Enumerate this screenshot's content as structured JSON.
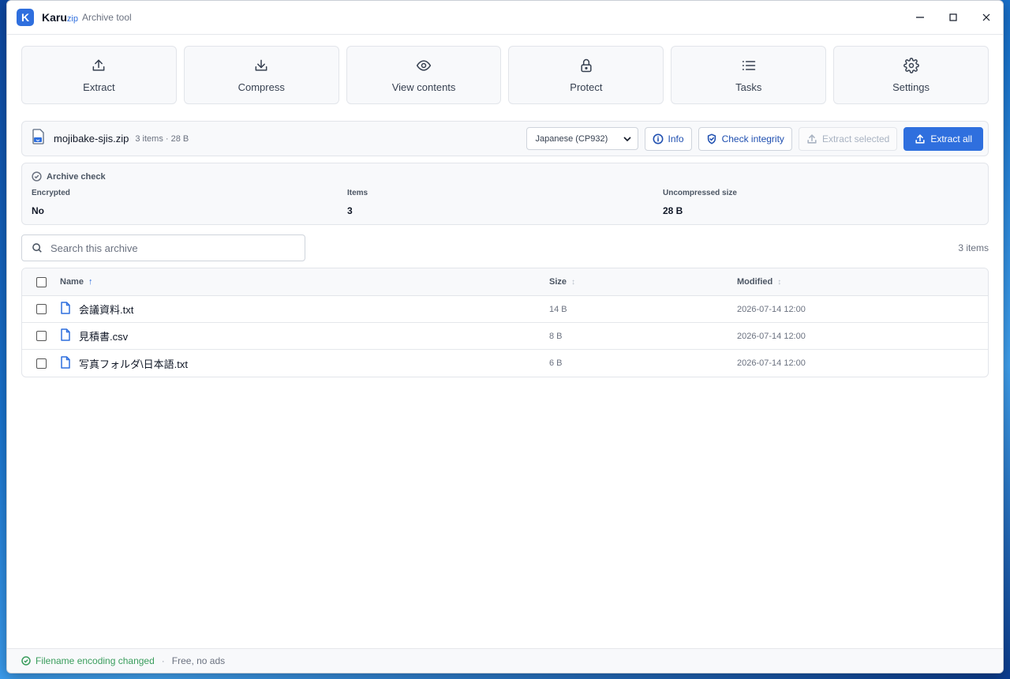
{
  "window": {
    "app_name": "Karu",
    "app_suffix": "zip",
    "subtitle": "Archive tool",
    "logo_letter": "K",
    "controls": {
      "minimize": "–",
      "maximize": "☐",
      "close": "✕"
    }
  },
  "toolbar": {
    "items": [
      {
        "label": "Extract",
        "icon": "upload-icon"
      },
      {
        "label": "Compress",
        "icon": "download-icon"
      },
      {
        "label": "View contents",
        "icon": "eye-icon"
      },
      {
        "label": "Protect",
        "icon": "lock-icon"
      },
      {
        "label": "Tasks",
        "icon": "list-icon"
      },
      {
        "label": "Settings",
        "icon": "gear-icon"
      }
    ]
  },
  "file": {
    "name": "mojibake-sjis.zip",
    "meta": "3 items · 28 B",
    "encoding": "Japanese (CP932)",
    "buttons": {
      "info": "Info",
      "check_integrity": "Check integrity",
      "extract_selected": "Extract selected",
      "extract_all": "Extract all"
    }
  },
  "archive_check": {
    "title": "Archive check",
    "fields": [
      {
        "label": "Encrypted",
        "value": "No"
      },
      {
        "label": "Items",
        "value": "3"
      },
      {
        "label": "Uncompressed size",
        "value": "28 B"
      }
    ]
  },
  "search": {
    "placeholder": "Search this archive",
    "count": "3 items"
  },
  "table": {
    "headers": {
      "name": "Name",
      "size": "Size",
      "modified": "Modified"
    },
    "sort_active": "↑",
    "sort_idle": "↕",
    "rows": [
      {
        "name": "会議資料.txt",
        "size": "14 B",
        "modified": "2026-07-14 12:00"
      },
      {
        "name": "見積書.csv",
        "size": "8 B",
        "modified": "2026-07-14 12:00"
      },
      {
        "name": "写真フォルダ\\日本語.txt",
        "size": "6 B",
        "modified": "2026-07-14 12:00"
      }
    ]
  },
  "status": {
    "message": "Filename encoding changed",
    "separator": "·",
    "note": "Free, no ads"
  },
  "colors": {
    "accent": "#2f6fde",
    "success": "#3a9d5d"
  }
}
